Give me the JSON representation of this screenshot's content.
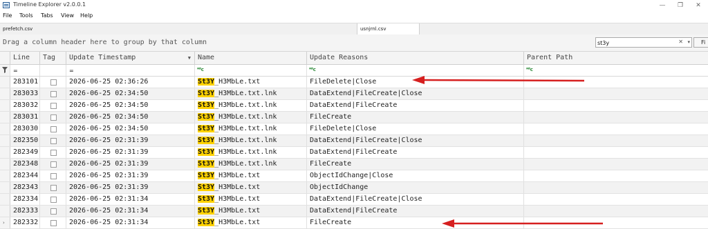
{
  "window": {
    "title": "Timeline Explorer v2.0.0.1",
    "minimize": "—",
    "restore": "❐",
    "close": "✕"
  },
  "menu": [
    "File",
    "Tools",
    "Tabs",
    "View",
    "Help"
  ],
  "tabs": [
    {
      "label": "prefetch.csv",
      "active": false
    },
    {
      "label": "usnjrnl.csv",
      "active": true
    }
  ],
  "groupbar": {
    "hint": "Drag a column header here to group by that column"
  },
  "search": {
    "value": "st3y",
    "clear": "✕",
    "dropdown": "▾",
    "find_label": "Fi"
  },
  "columns": {
    "line": "Line",
    "tag": "Tag",
    "timestamp": "Update Timestamp",
    "name": "Name",
    "reasons": "Update Reasons",
    "parent": "Parent Path"
  },
  "filters": {
    "eq": "=",
    "contains": "ᴿᴮc"
  },
  "highlight_term": "St3Y",
  "rows": [
    {
      "line": "283101",
      "ts": "2026-06-25 02:36:26",
      "name_rest": "_H3MbLe.txt",
      "reasons": "FileDelete|Close"
    },
    {
      "line": "283033",
      "ts": "2026-06-25 02:34:50",
      "name_rest": "_H3MbLe.txt.lnk",
      "reasons": "DataExtend|FileCreate|Close"
    },
    {
      "line": "283032",
      "ts": "2026-06-25 02:34:50",
      "name_rest": "_H3MbLe.txt.lnk",
      "reasons": "DataExtend|FileCreate"
    },
    {
      "line": "283031",
      "ts": "2026-06-25 02:34:50",
      "name_rest": "_H3MbLe.txt.lnk",
      "reasons": "FileCreate"
    },
    {
      "line": "283030",
      "ts": "2026-06-25 02:34:50",
      "name_rest": "_H3MbLe.txt.lnk",
      "reasons": "FileDelete|Close"
    },
    {
      "line": "282350",
      "ts": "2026-06-25 02:31:39",
      "name_rest": "_H3MbLe.txt.lnk",
      "reasons": "DataExtend|FileCreate|Close"
    },
    {
      "line": "282349",
      "ts": "2026-06-25 02:31:39",
      "name_rest": "_H3MbLe.txt.lnk",
      "reasons": "DataExtend|FileCreate"
    },
    {
      "line": "282348",
      "ts": "2026-06-25 02:31:39",
      "name_rest": "_H3MbLe.txt.lnk",
      "reasons": "FileCreate"
    },
    {
      "line": "282344",
      "ts": "2026-06-25 02:31:39",
      "name_rest": "_H3MbLe.txt",
      "reasons": "ObjectIdChange|Close"
    },
    {
      "line": "282343",
      "ts": "2026-06-25 02:31:39",
      "name_rest": "_H3MbLe.txt",
      "reasons": "ObjectIdChange"
    },
    {
      "line": "282334",
      "ts": "2026-06-25 02:31:34",
      "name_rest": "_H3MbLe.txt",
      "reasons": "DataExtend|FileCreate|Close"
    },
    {
      "line": "282333",
      "ts": "2026-06-25 02:31:34",
      "name_rest": "_H3MbLe.txt",
      "reasons": "DataExtend|FileCreate"
    },
    {
      "line": "282332",
      "ts": "2026-06-25 02:31:34",
      "name_rest": "_H3MbLe.txt",
      "reasons": "FileCreate"
    }
  ],
  "colors": {
    "highlight": "#ffd200",
    "annotation": "#d61f1f"
  }
}
